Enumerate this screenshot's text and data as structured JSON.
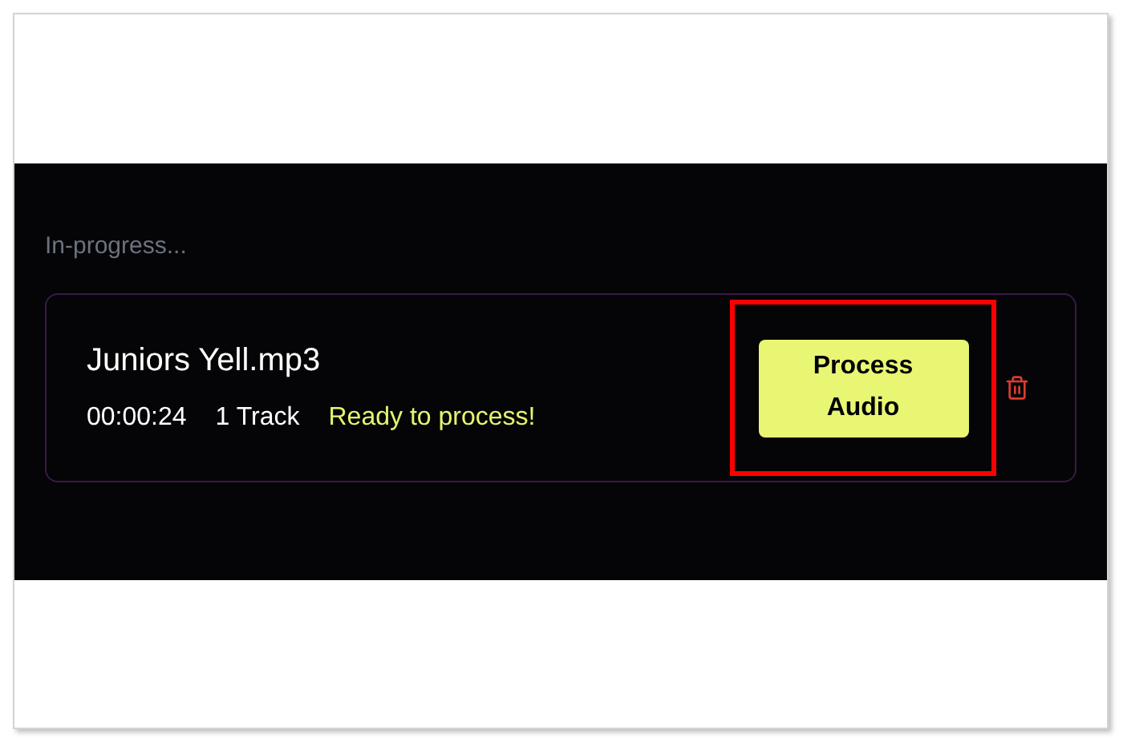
{
  "section_label": "In-progress...",
  "file": {
    "name": "Juniors Yell.mp3",
    "duration": "00:00:24",
    "tracks": "1 Track",
    "status": "Ready to process!",
    "action": "Process Audio",
    "highlighted": true
  }
}
